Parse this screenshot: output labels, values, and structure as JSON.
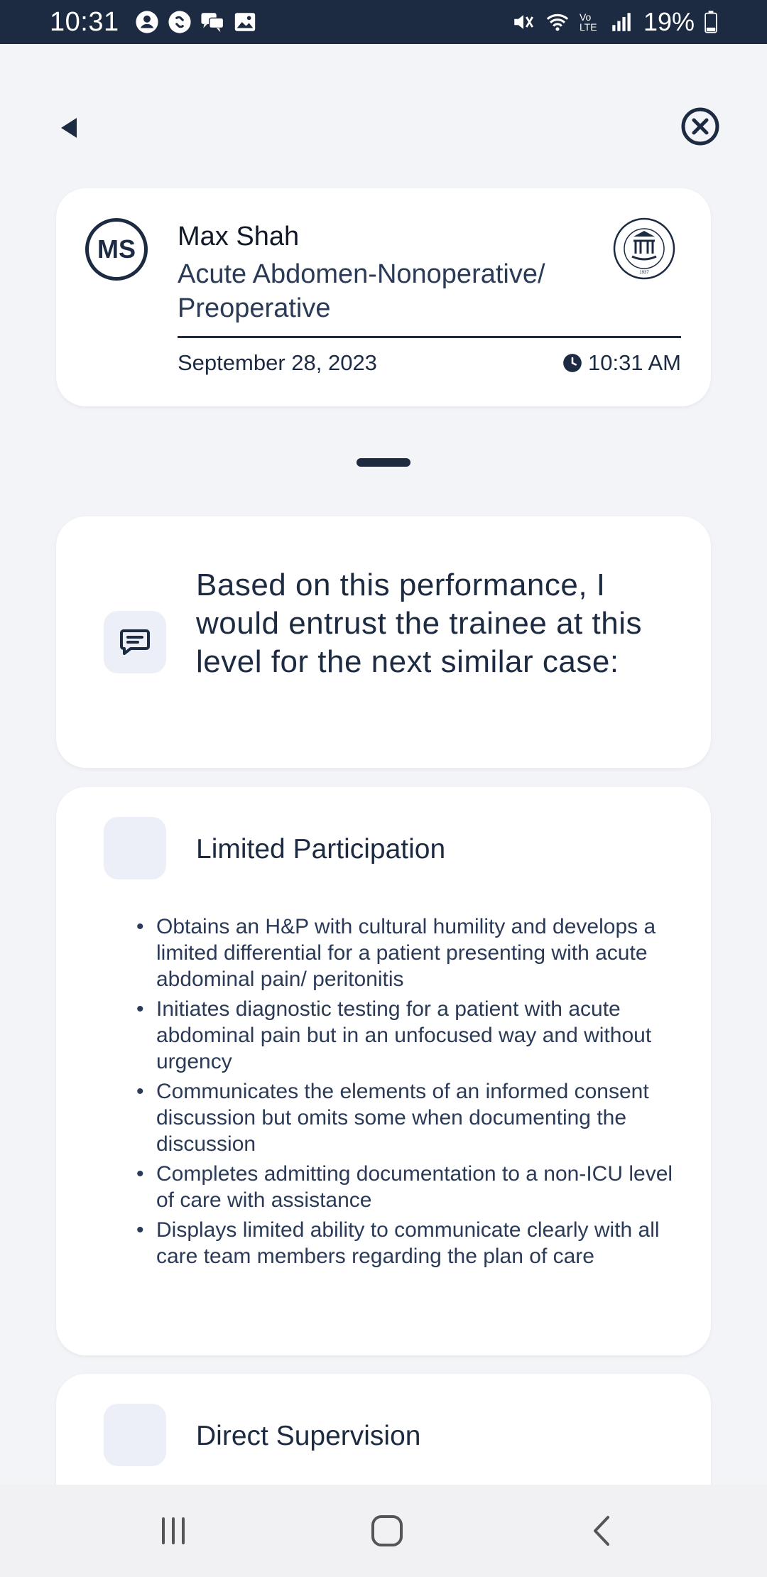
{
  "status_bar": {
    "time": "10:31",
    "battery": "19%",
    "left_icons": [
      "account-icon",
      "shazam-icon",
      "chat-icon",
      "image-icon"
    ],
    "right_icons": [
      "mute-icon",
      "wifi-icon",
      "volte-icon",
      "signal-icon",
      "battery-icon"
    ],
    "volte_label": "Vo LTE"
  },
  "nav": {
    "back_icon": "back-arrow-icon",
    "close_icon": "close-circle-icon"
  },
  "header": {
    "avatar_initials": "MS",
    "name": "Max Shah",
    "procedure": "Acute Abdomen-Nonoperative/ Preoperative",
    "date": "September 28, 2023",
    "time": "10:31 AM",
    "logo_text": "THE AMERICAN BOARD OF SURGERY",
    "logo_year": "1937"
  },
  "question": {
    "text": "Based on this performance, I would entrust the trainee at this level for the next similar case:"
  },
  "options": [
    {
      "title": "Limited Participation",
      "bullets": [
        "Obtains an H&P with cultural humility and develops a limited differential for a patient presenting with acute abdominal pain/ peritonitis",
        "Initiates diagnostic testing for a patient with acute abdominal pain but in an unfocused way and without urgency",
        "Communicates the elements of an informed consent discussion but omits some when documenting the discussion",
        "Completes admitting documentation to a non-ICU level of care with assistance",
        "Displays limited ability to communicate clearly with all care team members regarding the plan of care"
      ]
    },
    {
      "title": "Direct Supervision"
    }
  ],
  "colors": {
    "navy": "#1c2a42",
    "background": "#f3f4f8",
    "card": "#ffffff",
    "checkbox": "#eceff7"
  }
}
